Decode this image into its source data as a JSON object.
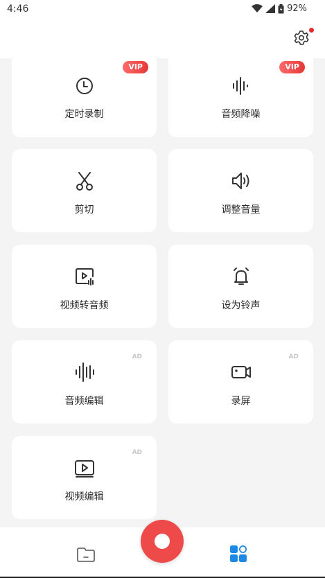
{
  "status": {
    "time": "4:46",
    "battery": "92%"
  },
  "header": {
    "settings_icon": "gear-icon"
  },
  "tools": [
    {
      "label": "定时录制",
      "icon": "clock-icon",
      "badge": "VIP"
    },
    {
      "label": "音频降噪",
      "icon": "waveform-icon",
      "badge": "VIP"
    },
    {
      "label": "剪切",
      "icon": "scissors-icon"
    },
    {
      "label": "调整音量",
      "icon": "volume-icon"
    },
    {
      "label": "视频转音频",
      "icon": "video-to-audio-icon"
    },
    {
      "label": "设为铃声",
      "icon": "bell-icon"
    },
    {
      "label": "音频编辑",
      "icon": "waveform-icon",
      "badge": "AD"
    },
    {
      "label": "录屏",
      "icon": "camera-record-icon",
      "badge": "AD"
    },
    {
      "label": "视频编辑",
      "icon": "video-play-icon",
      "badge": "AD"
    }
  ],
  "bottom_nav": {
    "left_icon": "folder-icon",
    "center_icon": "record-button",
    "right_icon": "apps-icon"
  },
  "colors": {
    "accent_red": "#ef4a4a",
    "accent_blue": "#1e88e5",
    "vip_red": "#e53935"
  }
}
